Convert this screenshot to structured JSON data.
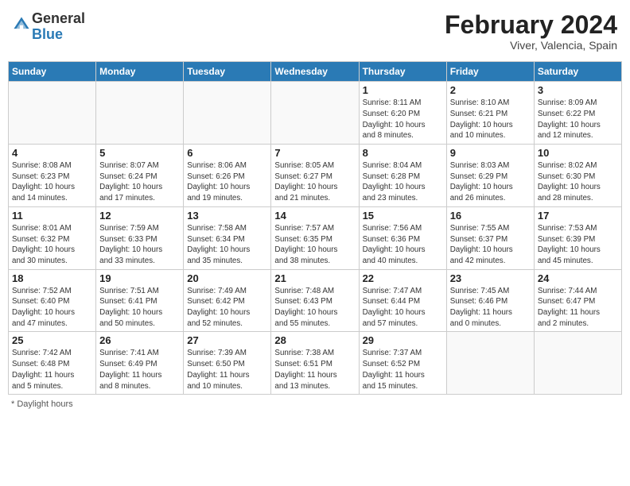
{
  "header": {
    "logo_general": "General",
    "logo_blue": "Blue",
    "month_year": "February 2024",
    "location": "Viver, Valencia, Spain"
  },
  "days_of_week": [
    "Sunday",
    "Monday",
    "Tuesday",
    "Wednesday",
    "Thursday",
    "Friday",
    "Saturday"
  ],
  "footer": {
    "daylight_label": "Daylight hours"
  },
  "weeks": [
    [
      {
        "day": "",
        "info": ""
      },
      {
        "day": "",
        "info": ""
      },
      {
        "day": "",
        "info": ""
      },
      {
        "day": "",
        "info": ""
      },
      {
        "day": "1",
        "info": "Sunrise: 8:11 AM\nSunset: 6:20 PM\nDaylight: 10 hours\nand 8 minutes."
      },
      {
        "day": "2",
        "info": "Sunrise: 8:10 AM\nSunset: 6:21 PM\nDaylight: 10 hours\nand 10 minutes."
      },
      {
        "day": "3",
        "info": "Sunrise: 8:09 AM\nSunset: 6:22 PM\nDaylight: 10 hours\nand 12 minutes."
      }
    ],
    [
      {
        "day": "4",
        "info": "Sunrise: 8:08 AM\nSunset: 6:23 PM\nDaylight: 10 hours\nand 14 minutes."
      },
      {
        "day": "5",
        "info": "Sunrise: 8:07 AM\nSunset: 6:24 PM\nDaylight: 10 hours\nand 17 minutes."
      },
      {
        "day": "6",
        "info": "Sunrise: 8:06 AM\nSunset: 6:26 PM\nDaylight: 10 hours\nand 19 minutes."
      },
      {
        "day": "7",
        "info": "Sunrise: 8:05 AM\nSunset: 6:27 PM\nDaylight: 10 hours\nand 21 minutes."
      },
      {
        "day": "8",
        "info": "Sunrise: 8:04 AM\nSunset: 6:28 PM\nDaylight: 10 hours\nand 23 minutes."
      },
      {
        "day": "9",
        "info": "Sunrise: 8:03 AM\nSunset: 6:29 PM\nDaylight: 10 hours\nand 26 minutes."
      },
      {
        "day": "10",
        "info": "Sunrise: 8:02 AM\nSunset: 6:30 PM\nDaylight: 10 hours\nand 28 minutes."
      }
    ],
    [
      {
        "day": "11",
        "info": "Sunrise: 8:01 AM\nSunset: 6:32 PM\nDaylight: 10 hours\nand 30 minutes."
      },
      {
        "day": "12",
        "info": "Sunrise: 7:59 AM\nSunset: 6:33 PM\nDaylight: 10 hours\nand 33 minutes."
      },
      {
        "day": "13",
        "info": "Sunrise: 7:58 AM\nSunset: 6:34 PM\nDaylight: 10 hours\nand 35 minutes."
      },
      {
        "day": "14",
        "info": "Sunrise: 7:57 AM\nSunset: 6:35 PM\nDaylight: 10 hours\nand 38 minutes."
      },
      {
        "day": "15",
        "info": "Sunrise: 7:56 AM\nSunset: 6:36 PM\nDaylight: 10 hours\nand 40 minutes."
      },
      {
        "day": "16",
        "info": "Sunrise: 7:55 AM\nSunset: 6:37 PM\nDaylight: 10 hours\nand 42 minutes."
      },
      {
        "day": "17",
        "info": "Sunrise: 7:53 AM\nSunset: 6:39 PM\nDaylight: 10 hours\nand 45 minutes."
      }
    ],
    [
      {
        "day": "18",
        "info": "Sunrise: 7:52 AM\nSunset: 6:40 PM\nDaylight: 10 hours\nand 47 minutes."
      },
      {
        "day": "19",
        "info": "Sunrise: 7:51 AM\nSunset: 6:41 PM\nDaylight: 10 hours\nand 50 minutes."
      },
      {
        "day": "20",
        "info": "Sunrise: 7:49 AM\nSunset: 6:42 PM\nDaylight: 10 hours\nand 52 minutes."
      },
      {
        "day": "21",
        "info": "Sunrise: 7:48 AM\nSunset: 6:43 PM\nDaylight: 10 hours\nand 55 minutes."
      },
      {
        "day": "22",
        "info": "Sunrise: 7:47 AM\nSunset: 6:44 PM\nDaylight: 10 hours\nand 57 minutes."
      },
      {
        "day": "23",
        "info": "Sunrise: 7:45 AM\nSunset: 6:46 PM\nDaylight: 11 hours\nand 0 minutes."
      },
      {
        "day": "24",
        "info": "Sunrise: 7:44 AM\nSunset: 6:47 PM\nDaylight: 11 hours\nand 2 minutes."
      }
    ],
    [
      {
        "day": "25",
        "info": "Sunrise: 7:42 AM\nSunset: 6:48 PM\nDaylight: 11 hours\nand 5 minutes."
      },
      {
        "day": "26",
        "info": "Sunrise: 7:41 AM\nSunset: 6:49 PM\nDaylight: 11 hours\nand 8 minutes."
      },
      {
        "day": "27",
        "info": "Sunrise: 7:39 AM\nSunset: 6:50 PM\nDaylight: 11 hours\nand 10 minutes."
      },
      {
        "day": "28",
        "info": "Sunrise: 7:38 AM\nSunset: 6:51 PM\nDaylight: 11 hours\nand 13 minutes."
      },
      {
        "day": "29",
        "info": "Sunrise: 7:37 AM\nSunset: 6:52 PM\nDaylight: 11 hours\nand 15 minutes."
      },
      {
        "day": "",
        "info": ""
      },
      {
        "day": "",
        "info": ""
      }
    ]
  ]
}
